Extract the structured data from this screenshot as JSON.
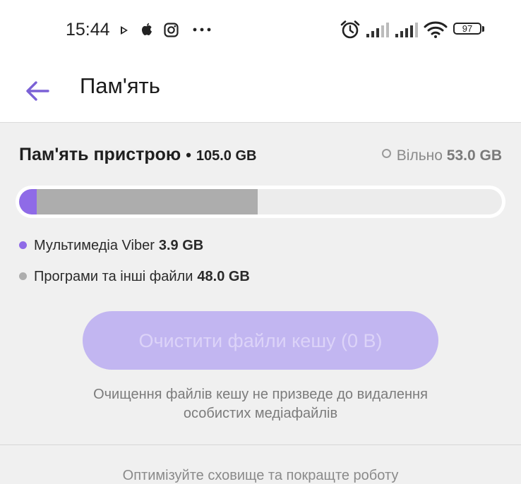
{
  "statusbar": {
    "time": "15:44",
    "battery": "97",
    "icons": [
      "play-icon",
      "apple-icon",
      "instagram-icon",
      "more-dots-icon",
      "alarm-icon",
      "signal-icon",
      "signal-icon",
      "wifi-icon",
      "battery-icon"
    ]
  },
  "appbar": {
    "title": "Пам'ять",
    "back_icon": "arrow-left-icon"
  },
  "storage": {
    "title": "Пам'ять пристрою",
    "separator": "•",
    "total": "105.0 GB",
    "free_label": "Вільно",
    "free_value": "53.0 GB",
    "usage": {
      "viber_fraction": 0.037,
      "other_fraction": 0.457
    },
    "legend": [
      {
        "label": "Мультимедіа Viber",
        "value": "3.9 GB",
        "color": "#8f6be7"
      },
      {
        "label": "Програми та інші файли",
        "value": "48.0 GB",
        "color": "#adadad"
      }
    ]
  },
  "clear_button": {
    "label": "Очистити файли кешу (0 B)"
  },
  "note": {
    "line1": "Очищення файлів кешу не призведе до видалення",
    "line2": "особистих медіафайлів"
  },
  "bottom": {
    "text": "Оптимізуйте сховище та покращте роботу"
  },
  "colors": {
    "accent": "#7b61d6",
    "viber": "#8f6be7",
    "other": "#adadad",
    "button_disabled": "#c2b6f1"
  }
}
